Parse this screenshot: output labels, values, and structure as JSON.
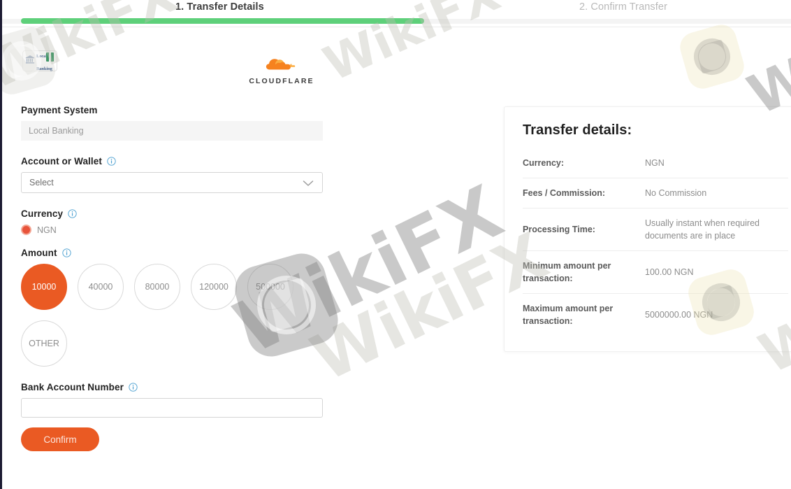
{
  "stepper": {
    "active_step": "1. Transfer Details",
    "inactive_step": "2. Confirm Transfer",
    "progress_percent": 53,
    "fill_color": "#5ed07a"
  },
  "brand": {
    "local_banking_line1": "Local",
    "local_banking_line2": "Banking",
    "cloudflare_word": "CLOUDFLARE"
  },
  "form": {
    "payment_system": {
      "label": "Payment System",
      "value": "Local Banking"
    },
    "account_or_wallet": {
      "label": "Account or Wallet",
      "placeholder": "Select",
      "value": "Select"
    },
    "currency": {
      "label": "Currency",
      "selected": "NGN",
      "options": [
        "NGN"
      ]
    },
    "amount": {
      "label": "Amount",
      "selected": "10000",
      "chips": [
        "10000",
        "40000",
        "80000",
        "120000",
        "500000",
        "OTHER"
      ]
    },
    "bank_account_number": {
      "label": "Bank Account Number",
      "value": "",
      "placeholder": ""
    },
    "confirm_label": "Confirm",
    "accent_color": "#ea5a23"
  },
  "details": {
    "title": "Transfer details:",
    "rows": [
      {
        "key": "Currency:",
        "value": "NGN"
      },
      {
        "key": "Fees / Commission:",
        "value": "No Commission"
      },
      {
        "key": "Processing Time:",
        "value": "Usually instant when required documents are in place"
      },
      {
        "key": "Minimum amount per transaction:",
        "value": "100.00 NGN"
      },
      {
        "key": "Maximum amount per transaction:",
        "value": "5000000.00 NGN"
      }
    ]
  },
  "watermark": {
    "text": "WikiFX"
  }
}
